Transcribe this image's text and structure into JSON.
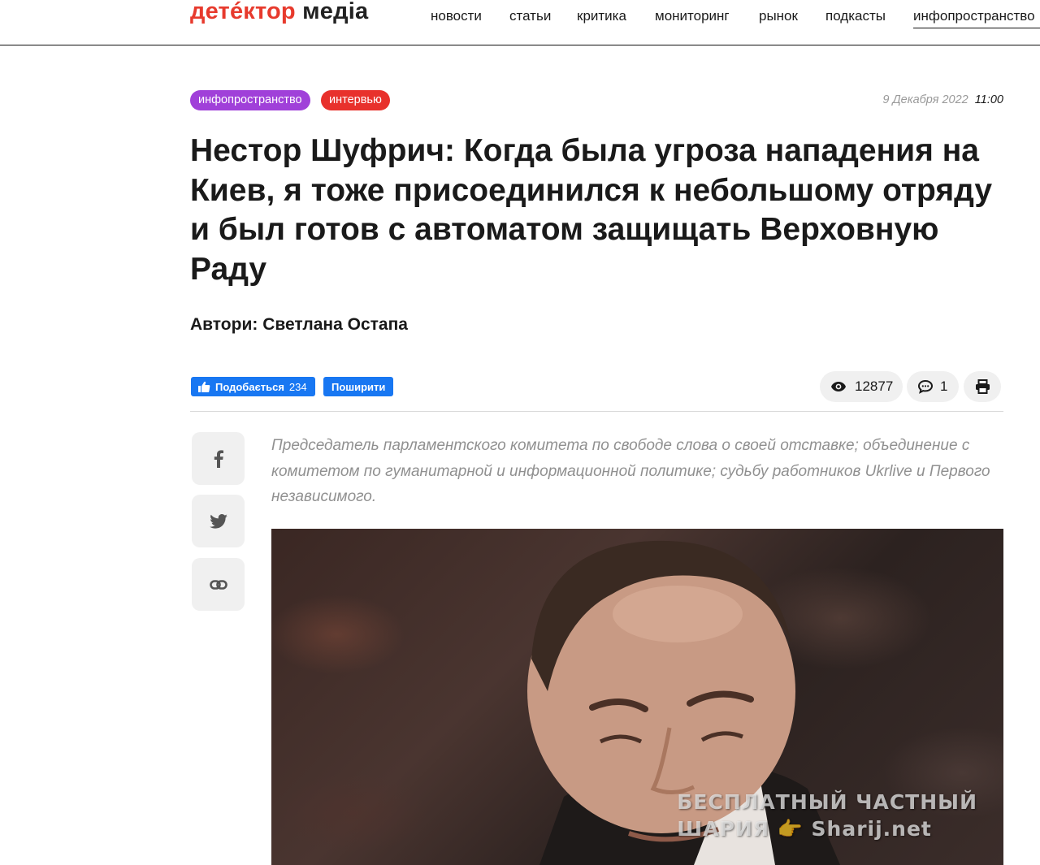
{
  "header": {
    "logo": {
      "part1": "детéктор",
      "part2": "медіа"
    },
    "nav": [
      "новости",
      "статьи",
      "критика",
      "мониторинг",
      "рынок",
      "подкасты",
      "инфопространство"
    ],
    "active_nav": "инфопространство"
  },
  "article": {
    "tags": [
      "инфопространство",
      "интервью"
    ],
    "date": "9 Декабря 2022",
    "time": "11:00",
    "title": "Нестор Шуфрич: Когда была угроза нападения на Киев, я тоже присоединился к небольшому отряду и был готов с автоматом защищать Верховную Раду",
    "authors": "Автори: Светлана Остапа",
    "lead": "Председатель парламентского комитета по свободе слова о своей отставке; объединение с комитетом по гуманитарной и информационной политике; судьбу работников Ukrlive и Первого независимого."
  },
  "social": {
    "like_label": "Подобається",
    "like_count": "234",
    "share_label": "Поширити",
    "views": "12877",
    "comments": "1"
  },
  "share_sidebar": {
    "icons": [
      "facebook-icon",
      "twitter-icon",
      "link-icon"
    ]
  },
  "watermark": {
    "line1": "БЕСПЛАТНЫЙ  ЧАСТНЫЙ",
    "line2": "ШАРИЯ 👉 Sharij.net"
  },
  "colors": {
    "brand_red": "#e73a2d",
    "tag_purple": "#a040d9",
    "tag_red": "#e8312c",
    "facebook_blue": "#1877f2"
  }
}
